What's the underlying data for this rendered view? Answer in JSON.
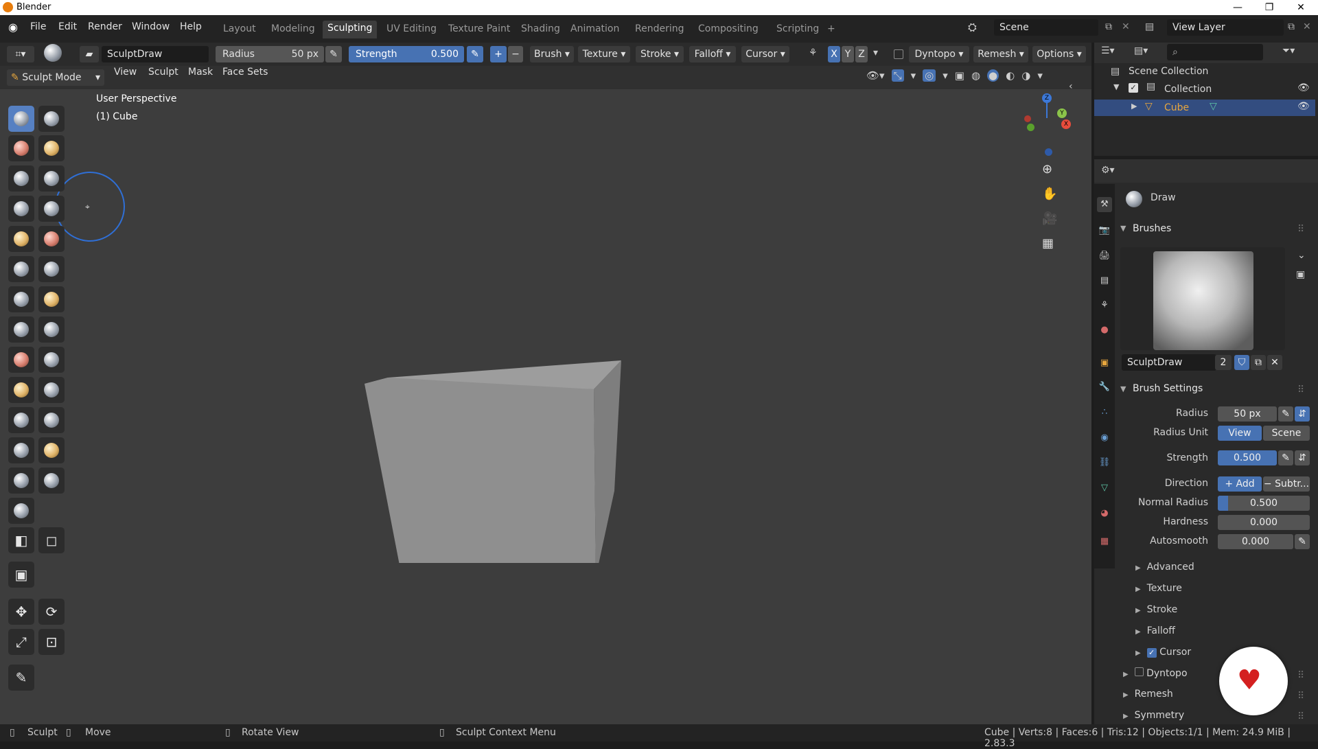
{
  "window": {
    "title": "Blender",
    "min": "—",
    "max": "❐",
    "close": "✕"
  },
  "menu": {
    "file": "File",
    "edit": "Edit",
    "render": "Render",
    "window": "Window",
    "help": "Help"
  },
  "workspaces": [
    "Layout",
    "Modeling",
    "Sculpting",
    "UV Editing",
    "Texture Paint",
    "Shading",
    "Animation",
    "Rendering",
    "Compositing",
    "Scripting",
    "+"
  ],
  "active_workspace": "Sculpting",
  "scene": {
    "label": "Scene",
    "view_layer": "View Layer"
  },
  "toolbar": {
    "brush_name": "SculptDraw",
    "radius_label": "Radius",
    "radius_value": "50 px",
    "strength_label": "Strength",
    "strength_value": "0.500",
    "plus": "+",
    "minus": "−",
    "brush": "Brush",
    "texture": "Texture",
    "stroke": "Stroke",
    "falloff": "Falloff",
    "cursor": "Cursor",
    "x": "X",
    "y": "Y",
    "z": "Z",
    "dyntopo": "Dyntopo",
    "remesh": "Remesh",
    "options": "Options"
  },
  "header": {
    "mode": "Sculpt Mode",
    "view": "View",
    "sculpt": "Sculpt",
    "mask": "Mask",
    "face_sets": "Face Sets"
  },
  "viewport": {
    "perspective": "User Perspective",
    "object": "(1) Cube"
  },
  "outliner": {
    "scene_collection": "Scene Collection",
    "collection": "Collection",
    "cube": "Cube"
  },
  "properties": {
    "tool_name": "Draw",
    "brushes_header": "Brushes",
    "brush_name": "SculptDraw",
    "brush_users": "2",
    "brush_settings_header": "Brush Settings",
    "radius_label": "Radius",
    "radius_value": "50 px",
    "radius_unit_label": "Radius Unit",
    "unit_view": "View",
    "unit_scene": "Scene",
    "strength_label": "Strength",
    "strength_value": "0.500",
    "direction_label": "Direction",
    "dir_add": "+ Add",
    "dir_sub": "− Subtr...",
    "normal_radius_label": "Normal Radius",
    "normal_radius_value": "0.500",
    "normal_radius_fill": 0.5,
    "hardness_label": "Hardness",
    "hardness_value": "0.000",
    "autosmooth_label": "Autosmooth",
    "autosmooth_value": "0.000",
    "sub_advanced": "Advanced",
    "sub_texture": "Texture",
    "sub_stroke": "Stroke",
    "sub_falloff": "Falloff",
    "sub_cursor": "Cursor",
    "dyntopo": "Dyntopo",
    "remesh": "Remesh",
    "symmetry": "Symmetry"
  },
  "statusbar": {
    "sculpt": "Sculpt",
    "move": "Move",
    "rotate": "Rotate View",
    "context": "Sculpt Context Menu",
    "stats": "Cube | Verts:8 | Faces:6 | Tris:12 | Objects:1/1 | Mem: 24.9 MiB | 2.83.3"
  },
  "colors": {
    "accent": "#4772b3",
    "header": "#2b2b2b",
    "viewport": "#3d3d3d",
    "active_object": "#e8a73e"
  }
}
